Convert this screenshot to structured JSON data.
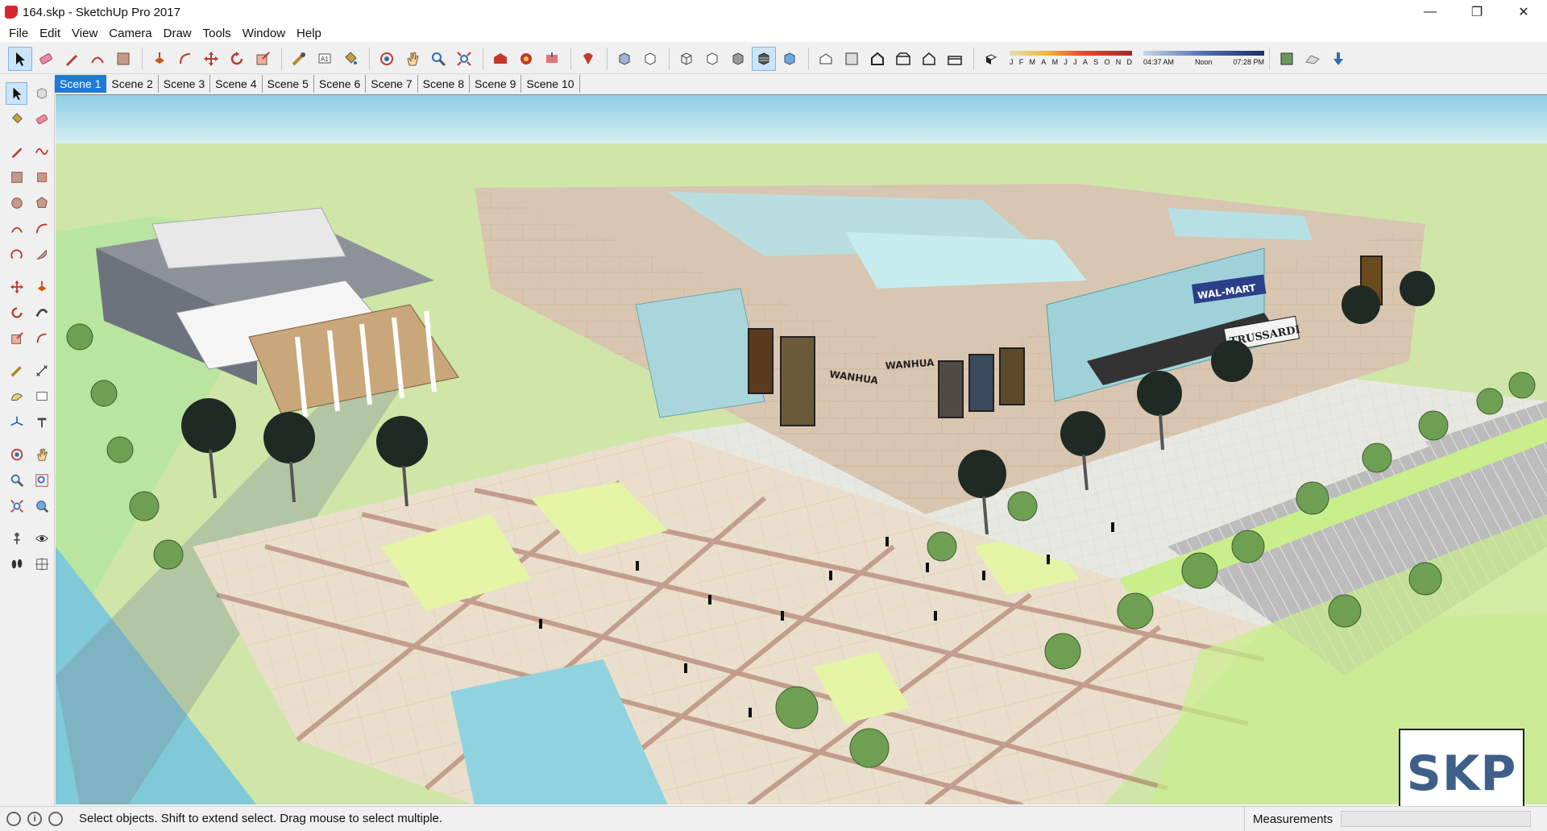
{
  "window": {
    "title": "164.skp - SketchUp Pro 2017",
    "minimize_glyph": "—",
    "restore_glyph": "❐",
    "close_glyph": "✕"
  },
  "menu": [
    "File",
    "Edit",
    "View",
    "Camera",
    "Draw",
    "Tools",
    "Window",
    "Help"
  ],
  "shadow": {
    "months": [
      "J",
      "F",
      "M",
      "A",
      "M",
      "J",
      "J",
      "A",
      "S",
      "O",
      "N",
      "D"
    ],
    "time_start": "04:37 AM",
    "time_mid": "Noon",
    "time_end": "07:28 PM"
  },
  "scenes": [
    "Scene 1",
    "Scene 2",
    "Scene 3",
    "Scene 4",
    "Scene 5",
    "Scene 6",
    "Scene 7",
    "Scene 8",
    "Scene 9",
    "Scene 10"
  ],
  "active_scene": "Scene 1",
  "model_signage": {
    "mall_name": "WANHUA",
    "anchor_store": "WAL-MART",
    "brand_store": "TRUSSARDI"
  },
  "status": {
    "message": "Select objects. Shift to extend select. Drag mouse to select multiple.",
    "measurements_label": "Measurements",
    "measurements_value": ""
  },
  "watermark": "SKP",
  "colors": {
    "sky_top": "#8fcfe6",
    "ground_green": "#a8d8a0",
    "grass_light": "#d7f0a4",
    "paving": "#e8ddc8",
    "building": "#d9c6b0",
    "glass": "#b7e0e4",
    "water": "#7fc9d8",
    "scene_active": "#1e7ad6"
  }
}
